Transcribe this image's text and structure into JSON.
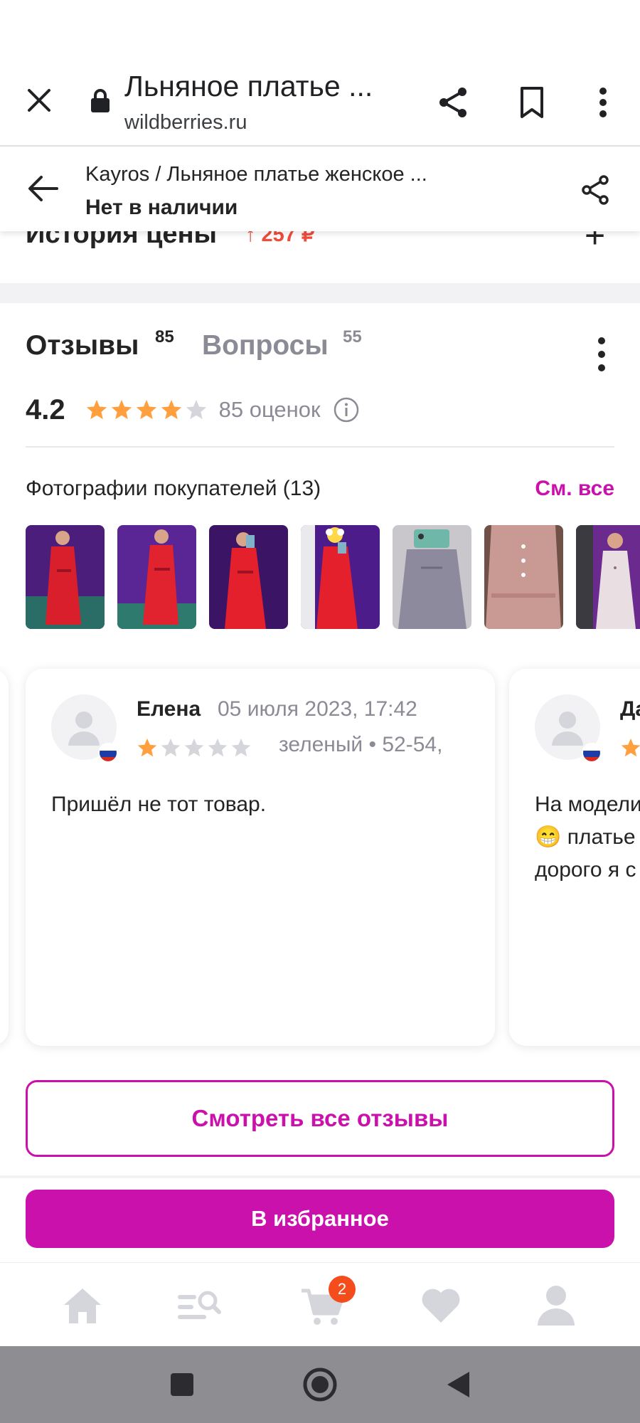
{
  "browser": {
    "title": "Льняное платье ...",
    "domain": "wildberries.ru"
  },
  "product_header": {
    "breadcrumb": "Kayros / Льняное платье женское ...",
    "availability": "Нет в наличии"
  },
  "price_history": {
    "title": "История цены",
    "delta": "↑ 257 ₽",
    "expand": "+"
  },
  "reviews": {
    "tabs": [
      {
        "label": "Отзывы",
        "count": "85"
      },
      {
        "label": "Вопросы",
        "count": "55"
      }
    ],
    "rating": "4.2",
    "rating_stars": 4,
    "rating_count": "85 оценок",
    "photos_title": "Фотографии покупателей (13)",
    "see_all": "См. все",
    "photos": [
      {
        "icon": "photo-red-dress-front"
      },
      {
        "icon": "photo-red-dress-side"
      },
      {
        "icon": "photo-red-dress-mirror"
      },
      {
        "icon": "photo-red-dress-emoji"
      },
      {
        "icon": "photo-grey-dress"
      },
      {
        "icon": "photo-pink-dress"
      },
      {
        "icon": "photo-light-dress"
      }
    ],
    "cards": [
      {
        "author": "Елена",
        "date": "05 июля 2023, 17:42",
        "stars": 1,
        "variant": "зеленый  •  52-54,",
        "text": "Пришёл не тот товар."
      },
      {
        "author": "Да",
        "date": "",
        "stars": 1,
        "variant": "",
        "text": "На модели\n😁 платье\nдорого я с"
      }
    ],
    "all_reviews_button": "Смотреть все отзывы"
  },
  "favorite_button": "В избранное",
  "bottom_nav": {
    "cart_badge": "2",
    "items": [
      "home-icon",
      "catalog-search-icon",
      "cart-icon",
      "heart-icon",
      "profile-icon"
    ]
  },
  "colors": {
    "accent": "#cb11ab",
    "star": "#ff9f3e",
    "star_empty": "#d5d5dc",
    "price_up": "#f14b3b",
    "badge": "#f54c1c"
  }
}
